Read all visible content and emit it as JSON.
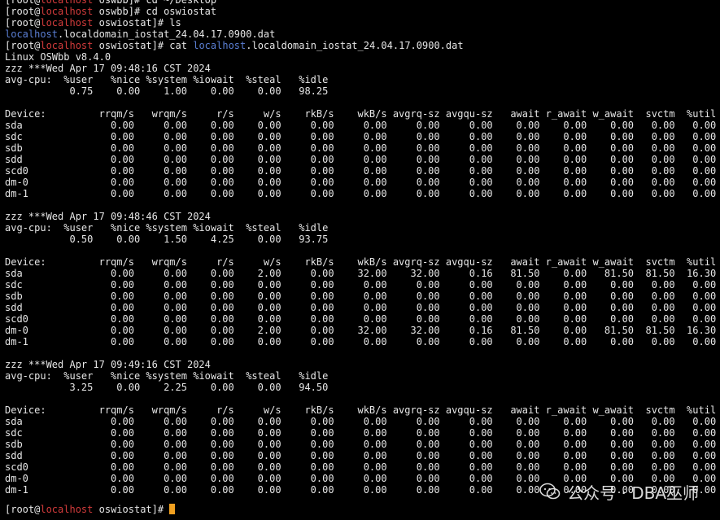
{
  "terminal": {
    "lines": [
      {
        "segments": [
          {
            "t": "[root@",
            "c": ""
          },
          {
            "t": "localhost",
            "c": "host"
          },
          {
            "t": " oswbb]# cd ~/Desktop",
            "c": ""
          }
        ]
      },
      {
        "segments": [
          {
            "t": "[root@",
            "c": ""
          },
          {
            "t": "localhost",
            "c": "host"
          },
          {
            "t": " oswbb]# cd oswiostat",
            "c": ""
          }
        ]
      },
      {
        "segments": [
          {
            "t": "[root@",
            "c": ""
          },
          {
            "t": "localhost",
            "c": "host"
          },
          {
            "t": " oswiostat]# ls",
            "c": ""
          }
        ]
      },
      {
        "segments": [
          {
            "t": "localhost",
            "c": "file"
          },
          {
            "t": ".localdomain_iostat_24.04.17.0900.dat",
            "c": ""
          }
        ]
      },
      {
        "segments": [
          {
            "t": "[root@",
            "c": ""
          },
          {
            "t": "localhost",
            "c": "host"
          },
          {
            "t": " oswiostat]# cat ",
            "c": ""
          },
          {
            "t": "localhost",
            "c": "file"
          },
          {
            "t": ".localdomain_iostat_24.04.17.0900.dat",
            "c": ""
          }
        ]
      },
      {
        "segments": [
          {
            "t": "Linux OSWbb v8.4.0",
            "c": ""
          }
        ]
      },
      {
        "segments": [
          {
            "t": "zzz ***Wed Apr 17 09:48:16 CST 2024",
            "c": ""
          }
        ]
      },
      {
        "segments": [
          {
            "t": "avg-cpu:  %user   %nice %system %iowait  %steal   %idle",
            "c": ""
          }
        ]
      },
      {
        "segments": [
          {
            "t": "           0.75    0.00    1.00    0.00    0.00   98.25",
            "c": ""
          }
        ]
      },
      {
        "segments": [
          {
            "t": "",
            "c": ""
          }
        ]
      },
      {
        "segments": [
          {
            "t": "Device:         rrqm/s   wrqm/s     r/s     w/s    rkB/s    wkB/s avgrq-sz avgqu-sz   await r_await w_await  svctm  %util",
            "c": ""
          }
        ]
      },
      {
        "segments": [
          {
            "t": "sda               0.00     0.00    0.00    0.00     0.00     0.00     0.00     0.00    0.00    0.00    0.00   0.00   0.00",
            "c": ""
          }
        ]
      },
      {
        "segments": [
          {
            "t": "sdc               0.00     0.00    0.00    0.00     0.00     0.00     0.00     0.00    0.00    0.00    0.00   0.00   0.00",
            "c": ""
          }
        ]
      },
      {
        "segments": [
          {
            "t": "sdb               0.00     0.00    0.00    0.00     0.00     0.00     0.00     0.00    0.00    0.00    0.00   0.00   0.00",
            "c": ""
          }
        ]
      },
      {
        "segments": [
          {
            "t": "sdd               0.00     0.00    0.00    0.00     0.00     0.00     0.00     0.00    0.00    0.00    0.00   0.00   0.00",
            "c": ""
          }
        ]
      },
      {
        "segments": [
          {
            "t": "scd0              0.00     0.00    0.00    0.00     0.00     0.00     0.00     0.00    0.00    0.00    0.00   0.00   0.00",
            "c": ""
          }
        ]
      },
      {
        "segments": [
          {
            "t": "dm-0              0.00     0.00    0.00    0.00     0.00     0.00     0.00     0.00    0.00    0.00    0.00   0.00   0.00",
            "c": ""
          }
        ]
      },
      {
        "segments": [
          {
            "t": "dm-1              0.00     0.00    0.00    0.00     0.00     0.00     0.00     0.00    0.00    0.00    0.00   0.00   0.00",
            "c": ""
          }
        ]
      },
      {
        "segments": [
          {
            "t": "",
            "c": ""
          }
        ]
      },
      {
        "segments": [
          {
            "t": "zzz ***Wed Apr 17 09:48:46 CST 2024",
            "c": ""
          }
        ]
      },
      {
        "segments": [
          {
            "t": "avg-cpu:  %user   %nice %system %iowait  %steal   %idle",
            "c": ""
          }
        ]
      },
      {
        "segments": [
          {
            "t": "           0.50    0.00    1.50    4.25    0.00   93.75",
            "c": ""
          }
        ]
      },
      {
        "segments": [
          {
            "t": "",
            "c": ""
          }
        ]
      },
      {
        "segments": [
          {
            "t": "Device:         rrqm/s   wrqm/s     r/s     w/s    rkB/s    wkB/s avgrq-sz avgqu-sz   await r_await w_await  svctm  %util",
            "c": ""
          }
        ]
      },
      {
        "segments": [
          {
            "t": "sda               0.00     0.00    0.00    2.00     0.00    32.00    32.00     0.16   81.50    0.00   81.50  81.50  16.30",
            "c": ""
          }
        ]
      },
      {
        "segments": [
          {
            "t": "sdc               0.00     0.00    0.00    0.00     0.00     0.00     0.00     0.00    0.00    0.00    0.00   0.00   0.00",
            "c": ""
          }
        ]
      },
      {
        "segments": [
          {
            "t": "sdb               0.00     0.00    0.00    0.00     0.00     0.00     0.00     0.00    0.00    0.00    0.00   0.00   0.00",
            "c": ""
          }
        ]
      },
      {
        "segments": [
          {
            "t": "sdd               0.00     0.00    0.00    0.00     0.00     0.00     0.00     0.00    0.00    0.00    0.00   0.00   0.00",
            "c": ""
          }
        ]
      },
      {
        "segments": [
          {
            "t": "scd0              0.00     0.00    0.00    0.00     0.00     0.00     0.00     0.00    0.00    0.00    0.00   0.00   0.00",
            "c": ""
          }
        ]
      },
      {
        "segments": [
          {
            "t": "dm-0              0.00     0.00    0.00    2.00     0.00    32.00    32.00     0.16   81.50    0.00   81.50  81.50  16.30",
            "c": ""
          }
        ]
      },
      {
        "segments": [
          {
            "t": "dm-1              0.00     0.00    0.00    0.00     0.00     0.00     0.00     0.00    0.00    0.00    0.00   0.00   0.00",
            "c": ""
          }
        ]
      },
      {
        "segments": [
          {
            "t": "",
            "c": ""
          }
        ]
      },
      {
        "segments": [
          {
            "t": "zzz ***Wed Apr 17 09:49:16 CST 2024",
            "c": ""
          }
        ]
      },
      {
        "segments": [
          {
            "t": "avg-cpu:  %user   %nice %system %iowait  %steal   %idle",
            "c": ""
          }
        ]
      },
      {
        "segments": [
          {
            "t": "           3.25    0.00    2.25    0.00    0.00   94.50",
            "c": ""
          }
        ]
      },
      {
        "segments": [
          {
            "t": "",
            "c": ""
          }
        ]
      },
      {
        "segments": [
          {
            "t": "Device:         rrqm/s   wrqm/s     r/s     w/s    rkB/s    wkB/s avgrq-sz avgqu-sz   await r_await w_await  svctm  %util",
            "c": ""
          }
        ]
      },
      {
        "segments": [
          {
            "t": "sda               0.00     0.00    0.00    0.00     0.00     0.00     0.00     0.00    0.00    0.00    0.00   0.00   0.00",
            "c": ""
          }
        ]
      },
      {
        "segments": [
          {
            "t": "sdc               0.00     0.00    0.00    0.00     0.00     0.00     0.00     0.00    0.00    0.00    0.00   0.00   0.00",
            "c": ""
          }
        ]
      },
      {
        "segments": [
          {
            "t": "sdb               0.00     0.00    0.00    0.00     0.00     0.00     0.00     0.00    0.00    0.00    0.00   0.00   0.00",
            "c": ""
          }
        ]
      },
      {
        "segments": [
          {
            "t": "sdd               0.00     0.00    0.00    0.00     0.00     0.00     0.00     0.00    0.00    0.00    0.00   0.00   0.00",
            "c": ""
          }
        ]
      },
      {
        "segments": [
          {
            "t": "scd0              0.00     0.00    0.00    0.00     0.00     0.00     0.00     0.00    0.00    0.00    0.00   0.00   0.00",
            "c": ""
          }
        ]
      },
      {
        "segments": [
          {
            "t": "dm-0              0.00     0.00    0.00    0.00     0.00     0.00     0.00     0.00    0.00    0.00    0.00   0.00   0.00",
            "c": ""
          }
        ]
      },
      {
        "segments": [
          {
            "t": "dm-1              0.00     0.00    0.00    0.00     0.00     0.00     0.00     0.00    0.00    0.00    0.00   0.00   0.00",
            "c": ""
          }
        ]
      }
    ],
    "prompt": {
      "prefix": "[root@",
      "host": "localhost",
      "suffix": " oswiostat]# "
    }
  },
  "watermark": {
    "icon": "wechat-icon",
    "text": "公众号 · DBA巫师"
  },
  "colors": {
    "background": "#000000",
    "text": "#e6e6e6",
    "host": "#d23b3b",
    "file": "#5b7fd4",
    "cursor": "#f0a020"
  }
}
